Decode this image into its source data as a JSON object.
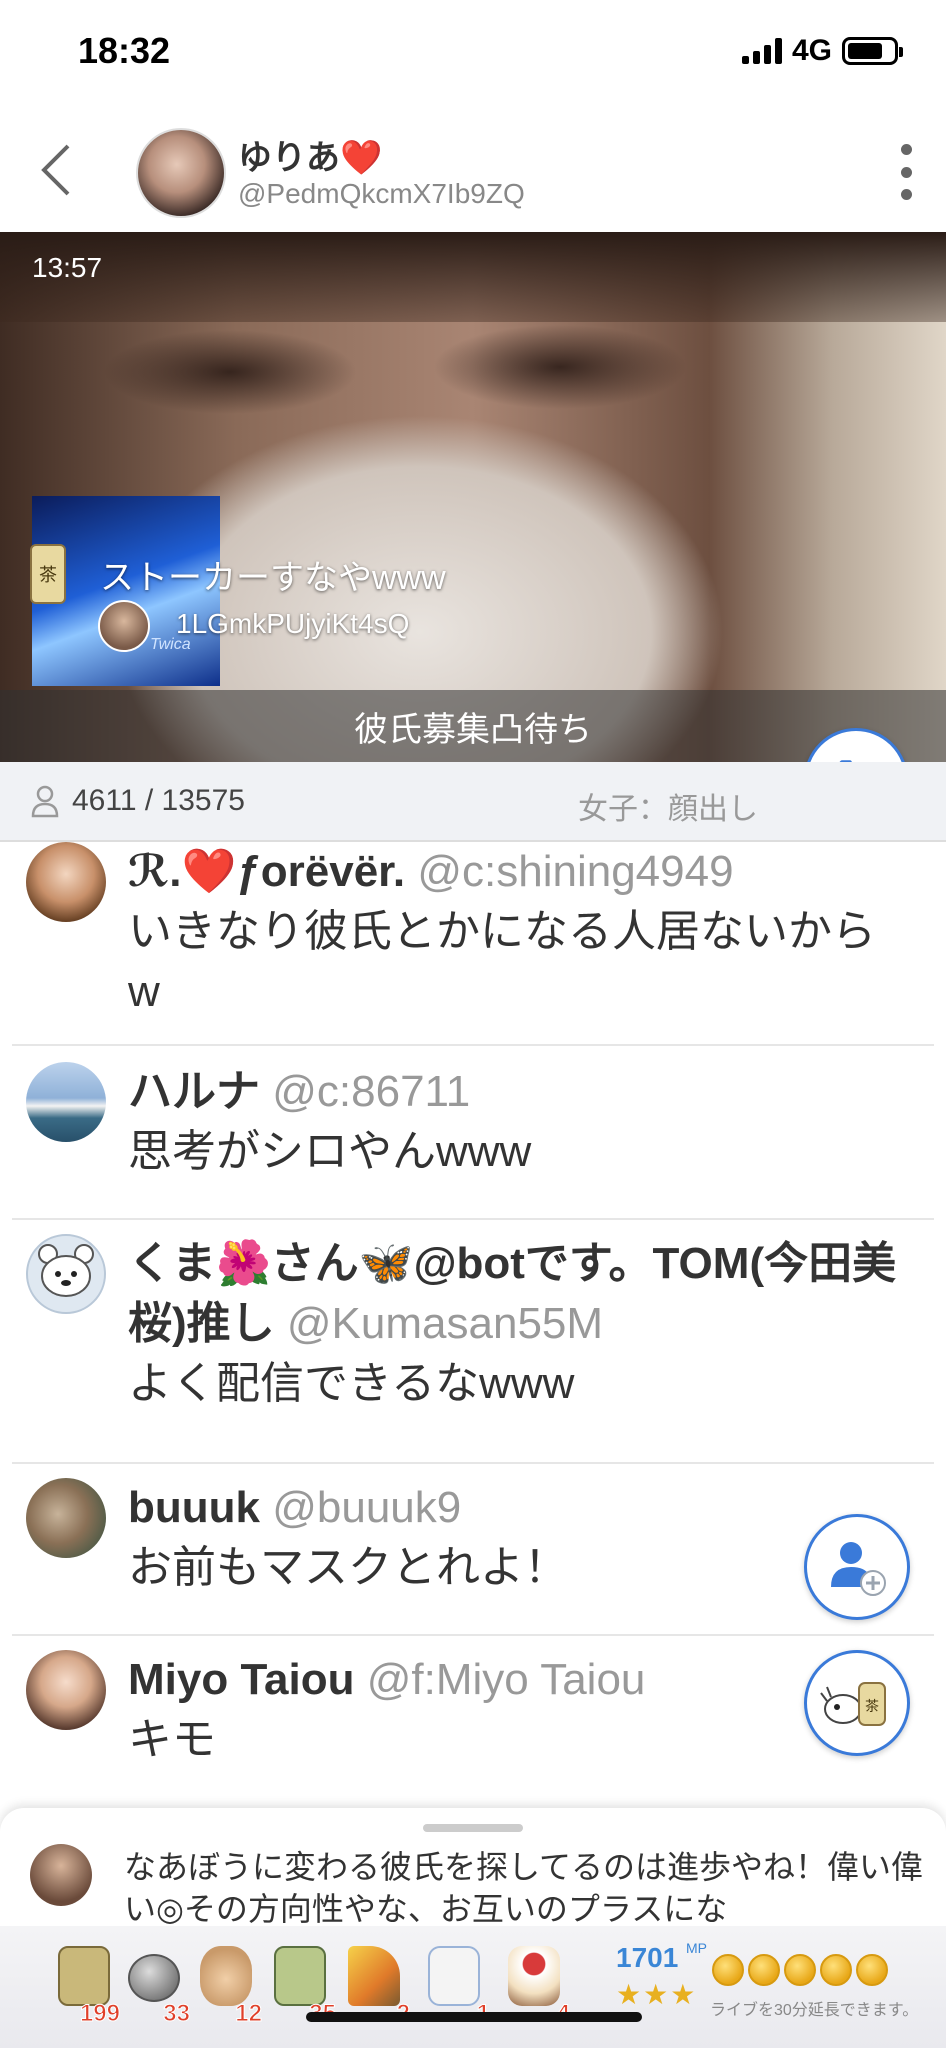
{
  "status_bar": {
    "time": "18:32",
    "network": "4G"
  },
  "header": {
    "host_name": "ゆりあ❤️",
    "host_id": "@PedmQkcmX7Ib9ZQ"
  },
  "video": {
    "elapsed": "13:57",
    "gift_message": "ストーカーすなやwww",
    "gift_sender_id": "1LGmkPUjyiKt4sQ",
    "gift_thumb_text": "Twica",
    "tea_icon_label": "茶",
    "caption": "彼氏募集凸待ち"
  },
  "stats": {
    "viewers": "4611 / 13575",
    "category": "女子：顔出し"
  },
  "comments": [
    {
      "name": "ℛ.❤️ƒorëvër.",
      "handle": "@c:shining4949",
      "text": "いきなり彼氏とかになる人居ないからw"
    },
    {
      "name": "ハルナ",
      "handle": "@c:86711",
      "text": "思考がシロやんwww"
    },
    {
      "name": "くま🌺さん🦋@botです。TOM(今田美桜)推し",
      "handle": "@Kumasan55M",
      "text": "よく配信できるなwww"
    },
    {
      "name": "buuuk",
      "handle": "@buuuk9",
      "text": "お前もマスクとれよ！"
    },
    {
      "name": "Miyo Taiou",
      "handle": "@f:Miyo Taiou",
      "text": "キモ"
    }
  ],
  "bottom_sheet": {
    "text": "なあぼうに変わる彼氏を探してるのは進歩やね！偉い偉い◎その方向性やな、お互いのプラスにな"
  },
  "gift_bar": {
    "items": [
      {
        "icon": "tea-cup-icon",
        "count": "199"
      },
      {
        "icon": "coin-stack-icon",
        "count": "33"
      },
      {
        "icon": "clap-hands-icon",
        "count": "12"
      },
      {
        "icon": "tea-10-icon",
        "count": "35"
      },
      {
        "icon": "party-popper-icon",
        "count": "2"
      },
      {
        "icon": "penguin-icon",
        "count": "1"
      },
      {
        "icon": "cake-icon",
        "count": "4"
      }
    ],
    "points": "1701",
    "points_unit": "MP",
    "stars": "★★★",
    "extend_text": "ライブを30分延長できます。"
  },
  "colors": {
    "accent": "#3a7ad9",
    "gift_count": "#e0402a",
    "points": "#3a86d6"
  }
}
